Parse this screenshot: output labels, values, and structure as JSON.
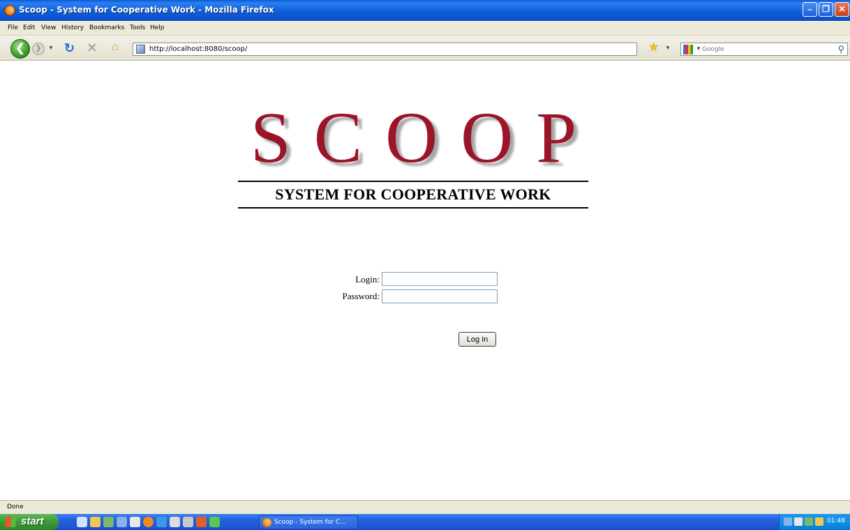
{
  "window": {
    "title": "Scoop - System for Cooperative Work - Mozilla Firefox"
  },
  "menu": {
    "items": [
      "File",
      "Edit",
      "View",
      "History",
      "Bookmarks",
      "Tools",
      "Help"
    ]
  },
  "navigation": {
    "url": "http://localhost:8080/scoop/",
    "search_placeholder": "Google"
  },
  "page": {
    "logo": "SCOOP",
    "tagline": "SYSTEM FOR COOPERATIVE WORK",
    "login_label": "Login:",
    "password_label": "Password:",
    "login_button": "Log In"
  },
  "status": {
    "text": "Done"
  },
  "taskbar": {
    "start_label": "start",
    "task_label": "Scoop - System for C...",
    "clock": "01:48"
  },
  "icons": {
    "back": "back-arrow-icon",
    "forward": "forward-arrow-icon",
    "reload": "reload-icon",
    "stop": "stop-icon",
    "home": "home-icon",
    "bookmark": "star-icon",
    "search": "magnifier-icon"
  },
  "colors": {
    "logo": "#9b1428",
    "titlebar": "#0a5bd6",
    "taskbar": "#245edb",
    "start_button": "#3c9a37"
  }
}
